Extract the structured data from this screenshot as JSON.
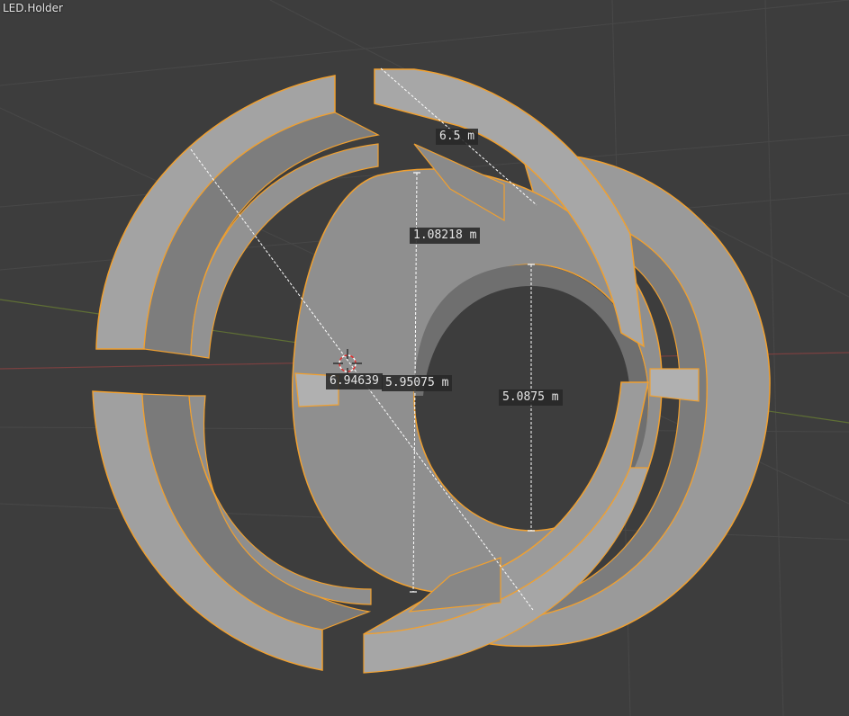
{
  "viewport": {
    "object_name": "LED.Holder",
    "colors": {
      "background": "#3d3d3d",
      "grid": "#4a4a4a",
      "x_axis": "#8a4545",
      "y_axis": "#6b7d3a",
      "selection_outline": "#f0a030",
      "mesh_light": "#a6a6a6",
      "mesh_mid": "#8c8c8c",
      "mesh_dark": "#6e6e6e"
    },
    "icons": [
      "3d-cursor-icon"
    ],
    "measurements": [
      {
        "id": "m1",
        "text": "6.5 m"
      },
      {
        "id": "m2",
        "text": "1.08218 m"
      },
      {
        "id": "m3",
        "text": "6.94639"
      },
      {
        "id": "m4",
        "text": "5.95075 m"
      },
      {
        "id": "m5",
        "text": "5.0875 m"
      }
    ]
  }
}
